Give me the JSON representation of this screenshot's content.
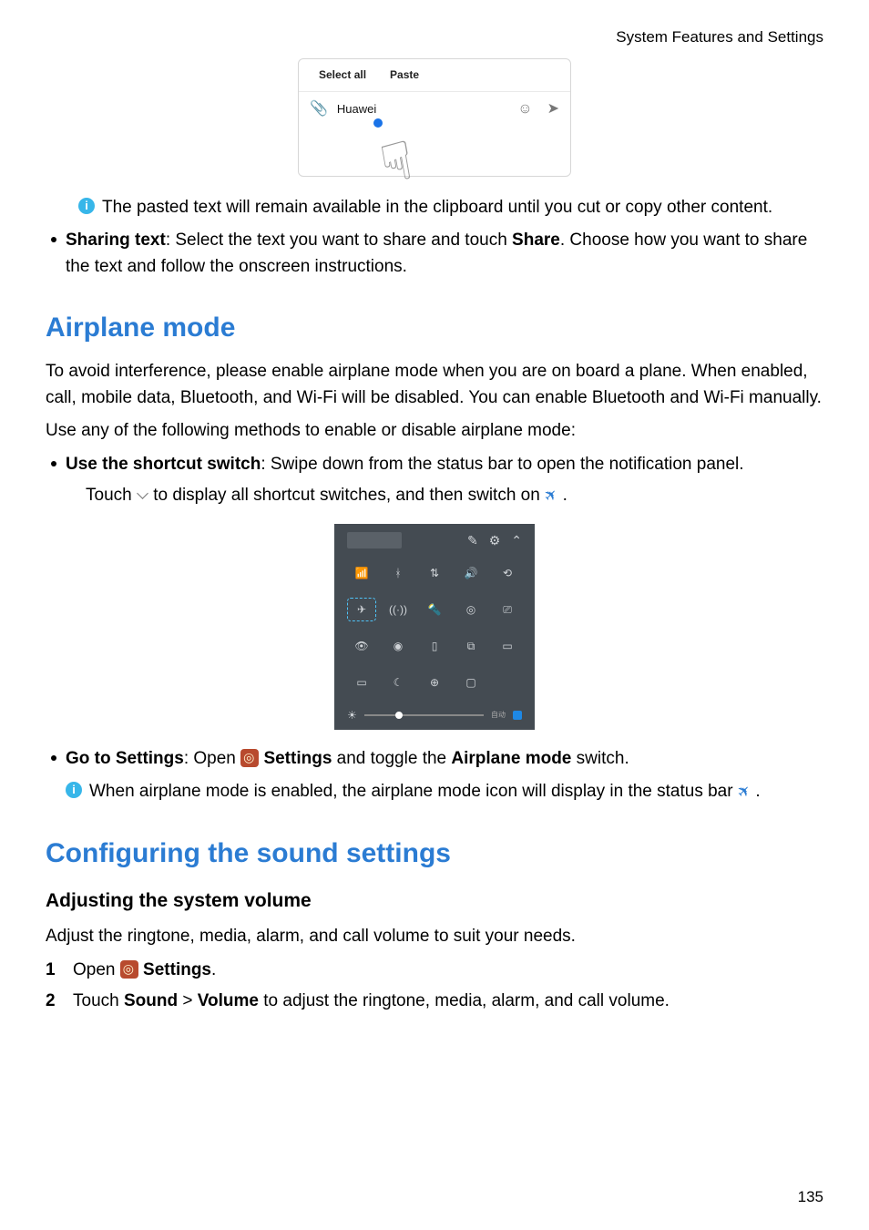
{
  "header": {
    "category": "System Features and Settings"
  },
  "paste_demo": {
    "select_all": "Select all",
    "paste": "Paste",
    "input_text": "Huawei"
  },
  "paste_info": "The pasted text will remain available in the clipboard until you cut or copy other content.",
  "sharing": {
    "label": "Sharing text",
    "desc_lead": ": Select the text you want to share and touch ",
    "share_word": "Share",
    "desc_tail": ". Choose how you want to share the text and follow the onscreen instructions."
  },
  "airplane": {
    "heading": "Airplane mode",
    "intro": "To avoid interference, please enable airplane mode when you are on board a plane. When enabled, call, mobile data, Bluetooth, and Wi-Fi will be disabled. You can enable Bluetooth and Wi-Fi manually.",
    "use_line": "Use any of the following methods to enable or disable airplane mode:",
    "shortcut_label": "Use the shortcut switch",
    "shortcut_desc": ": Swipe down from the status bar to open the notification panel.",
    "touch_part1": "Touch ",
    "touch_part2": " to display all shortcut switches, and then switch on ",
    "touch_part3": " .",
    "goto_label": "Go to Settings",
    "goto_open": ": Open ",
    "settings_word": "Settings",
    "goto_mid": " and toggle the ",
    "airplane_mode_word": "Airplane mode",
    "goto_tail": " switch.",
    "enabled_info_1": "When airplane mode is enabled, the airplane mode icon will display in the status bar ",
    "enabled_info_2": " ."
  },
  "sound": {
    "heading": "Configuring the sound settings",
    "sub": "Adjusting the system volume",
    "intro": "Adjust the ringtone, media, alarm, and call volume to suit your needs.",
    "step1_num": "1",
    "step1_a": "Open ",
    "step1_b": "Settings",
    "step1_c": ".",
    "step2_num": "2",
    "step2_a": "Touch ",
    "step2_b": "Sound",
    "step2_sep": " > ",
    "step2_c": "Volume",
    "step2_d": " to adjust the ringtone, media, alarm, and call volume."
  },
  "page_number": "135"
}
